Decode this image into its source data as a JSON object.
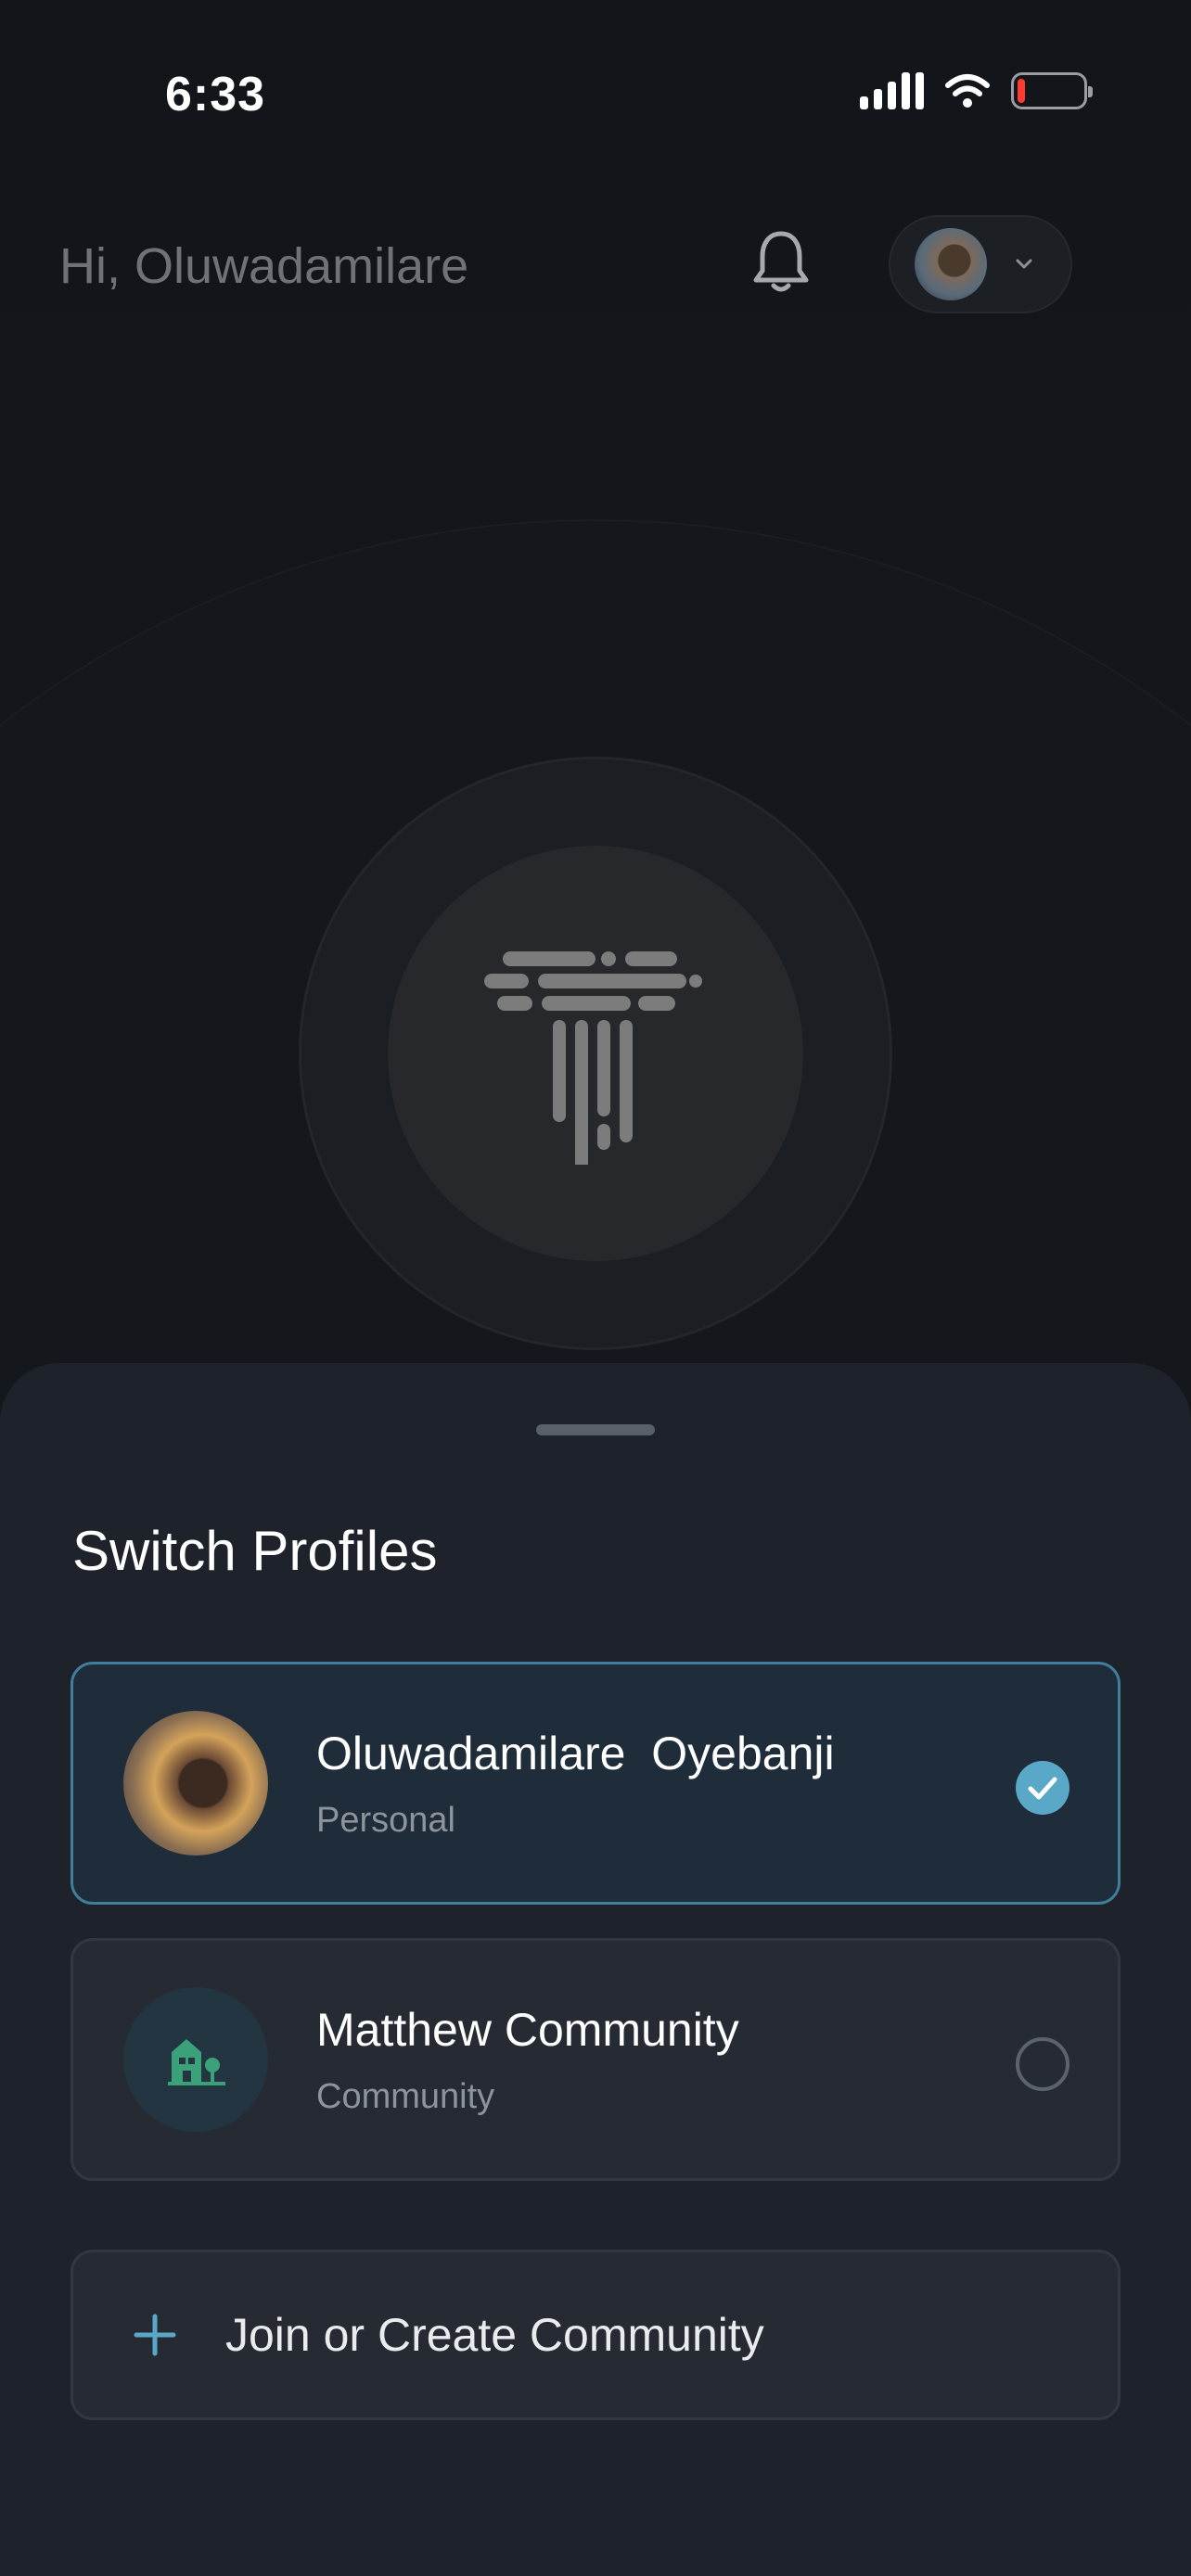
{
  "status_bar": {
    "time": "6:33",
    "battery_level": 0.1,
    "battery_color": "#ff3b30"
  },
  "header": {
    "greeting": "Hi, Oluwadamilare",
    "bell_icon": "bell-icon",
    "chevron_icon": "chevron-down-icon"
  },
  "logo": {
    "icon": "app-logo-icon"
  },
  "sheet": {
    "title": "Switch Profiles",
    "profiles": [
      {
        "name": "Oluwadamilare  Oyebanji",
        "type": "Personal",
        "selected": true
      },
      {
        "name": "Matthew Community",
        "type": "Community",
        "selected": false
      }
    ],
    "join_label": "Join or Create Community"
  },
  "colors": {
    "accent": "#5aa8c7",
    "community_icon": "#3aa17a",
    "plus_icon": "#5aa8c7"
  }
}
